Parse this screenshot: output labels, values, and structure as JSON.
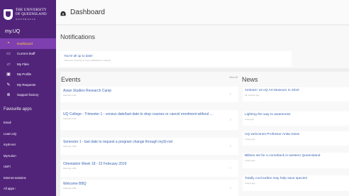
{
  "brand": {
    "line1": "THE UNIVERSITY",
    "line2": "OF QUEENSLAND",
    "line3": "AUSTRALIA",
    "primary_color": "#51247a",
    "accent_color": "#ffcc33"
  },
  "sidebar": {
    "section_title": "my.UQ",
    "items": [
      {
        "label": "Dashboard",
        "icon": "dashboard-icon"
      },
      {
        "label": "Current Staff",
        "icon": "monitor-icon"
      },
      {
        "label": "My Files",
        "icon": "folder-icon"
      },
      {
        "label": "My Profile",
        "icon": "profile-card-icon"
      },
      {
        "label": "My Requests",
        "icon": "edit-icon"
      },
      {
        "label": "Support factory",
        "icon": "plus-circle-icon"
      }
    ],
    "favourites_title": "Favourite apps",
    "favourites": [
      "Email",
      "Learn.UQ",
      "mySI-net",
      "MyAurion",
      "UniFi",
      "Internet sessions",
      "All apps  ›"
    ]
  },
  "header": {
    "title": "Dashboard"
  },
  "notifications": {
    "title": "Notifications",
    "message": "You're all up to date!",
    "submessage": "There are currently no new notifications to display"
  },
  "events": {
    "title": "Events",
    "view_all": "View all",
    "items": [
      {
        "title": "Asian Studies Research Camp",
        "date": "February 11th"
      },
      {
        "title": "UQ College - Trimester 1 - census date/last date to drop courses or cancel enrolment without ...",
        "date": "February 11th"
      },
      {
        "title": "Semester 1 - last date to request a program change through mySI-net",
        "date": "February 15th"
      },
      {
        "title": "Orientation Week 18 - 22 February 2019",
        "date": "February 18th"
      },
      {
        "title": "Welcome BBQ",
        "date": "February 18th"
      }
    ]
  },
  "news": {
    "title": "News",
    "items": [
      {
        "title": "'Unlearn' at UQ Art Museum in 2019",
        "date": "44 minutes ago"
      },
      {
        "title": "Lighting the way to awareness",
        "date": "a day ago"
      },
      {
        "title": "UQ welcomes Professor Anita Heiss",
        "date": "2 days ago"
      },
      {
        "title": "Bilbies set for a comeback in western Queensland",
        "date": "2 days ago"
      },
      {
        "title": "Totally cool turtles may help save species",
        "date": "3 days ago"
      }
    ]
  }
}
